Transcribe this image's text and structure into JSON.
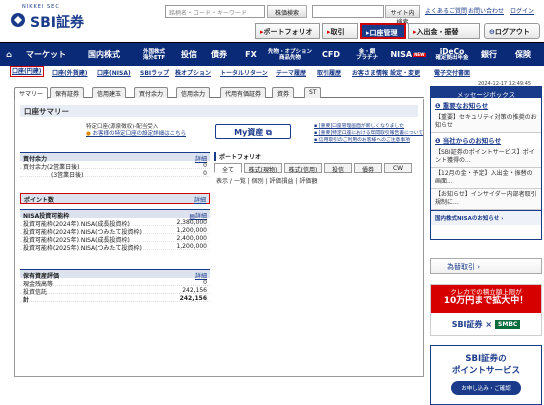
{
  "header": {
    "brand_sub": "NIKKEI SEC",
    "brand": "SBI証券",
    "search_placeholder": "銘柄名・コード・キーワード",
    "stock_search": "株価検索",
    "site_search": "サイト内検索",
    "links": [
      "よくあるご質問",
      "お問い合わせ",
      "ログイン"
    ],
    "nav_buttons": [
      "ポートフォリオ",
      "取引",
      "口座管理",
      "入出金・振替"
    ],
    "logout": "ログアウト"
  },
  "main_nav": [
    {
      "label": "マーケット"
    },
    {
      "label": "国内株式"
    },
    {
      "label": "外国株式\n海外ETF"
    },
    {
      "label": "投信"
    },
    {
      "label": "債券"
    },
    {
      "label": "FX"
    },
    {
      "label": "先物・オプション\n商品先物"
    },
    {
      "label": "CFD"
    },
    {
      "label": "金・銀\nプラチナ"
    },
    {
      "label": "NISA",
      "badge": "NEW"
    },
    {
      "label": "iDeCo\n確定拠出年金"
    },
    {
      "label": "銀行"
    },
    {
      "label": "保険"
    }
  ],
  "sub_nav": [
    "口座(円建)",
    "口座(外貨建)",
    "口座(NISA)",
    "SBIラップ",
    "株オプション",
    "トータルリターン",
    "テーマ履歴",
    "取引履歴",
    "お客さま情報 設定・変更",
    "電子交付書面"
  ],
  "timestamp": "2024-12-17 12:49:45",
  "tabs": [
    "サマリー",
    "保有証券",
    "信用建玉",
    "買付余力",
    "信用余力",
    "代用有価証券",
    "資券",
    "ST"
  ],
  "summary": {
    "title": "口座サマリー",
    "promo_line1": "特定口座(源泉徴収)-配当受入",
    "promo_line2": "お客様の特定口座の設定詳細はこちら",
    "my_asset": "My資産",
    "notes": [
      "[重要]口座管理画面が新しくなりました",
      "[重要]特定口座における年間取引報告書について",
      "信用取引のご利用のお客様へのご注意事項"
    ]
  },
  "kaitsuke": {
    "title": "買付余力",
    "detail": "詳細",
    "rows": [
      {
        "label": "買付余力(2営業日後)",
        "value": "0"
      },
      {
        "label": "(3営業日後)",
        "value": "0"
      }
    ]
  },
  "point": {
    "title": "ポイント数",
    "detail": "詳細"
  },
  "nisa": {
    "title": "NISA投資可能枠",
    "detail": "詳細",
    "rows": [
      {
        "label": "投資可能枠(2024年)",
        "type": "NISA(成長投資枠)",
        "value": "2,380,000"
      },
      {
        "label": "投資可能枠(2024年)",
        "type": "NISA(つみたて投資枠)",
        "value": "1,200,000"
      },
      {
        "label": "投資可能枠(2025年)",
        "type": "NISA(成長投資枠)",
        "value": "2,400,000"
      },
      {
        "label": "投資可能枠(2025年)",
        "type": "NISA(つみたて投資枠)",
        "value": "1,200,000"
      }
    ]
  },
  "hoyu": {
    "title": "保有資産評価",
    "detail": "詳細",
    "rows": [
      {
        "label": "現金残高等",
        "value": "0"
      },
      {
        "label": "投資信託",
        "value": "242,156"
      },
      {
        "label": "計",
        "value": "242,156"
      }
    ]
  },
  "portfolio": {
    "title": "ポートフォリオ",
    "tabs": [
      "全て",
      "株式(現物)",
      "株式(信用)",
      "投信",
      "債券",
      "CW"
    ],
    "options": "表示 / 一覧 | 個別 | 評価損益 | 評価額"
  },
  "sidebar": {
    "msg_title": "メッセージボックス",
    "important_link": "重要なお知らせ",
    "important_item": "【重要】セキュリティ対策の推奨のお知らせ",
    "notice_link": "当社からのお知らせ",
    "notice_items": [
      "【SBI証券のポイントサービス】ポイント獲得の...",
      "【12月の金・予定】入出金・振替の画面...",
      "【お知らせ】インサイダー内部者取引規制に..."
    ],
    "nisa_link": "国内株式NISAのお知らせ",
    "tameru": "為替取引",
    "ad1_top": "クレカでの積立額上限が",
    "ad1_big": "10万円まで拡大中！",
    "ad1_bottom": "SBI証券",
    "ad1_smbc": "SMBC",
    "ad2_l1": "SBI証券の",
    "ad2_l2": "ポイントサービス",
    "ad2_btn": "お申し込み・ご確認"
  }
}
